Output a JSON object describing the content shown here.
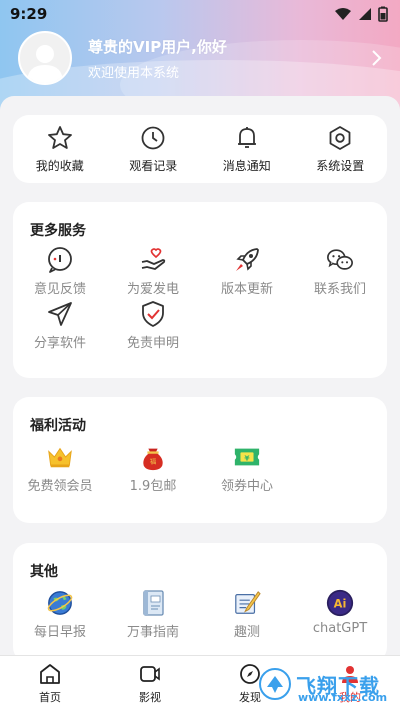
{
  "status": {
    "time": "9:29"
  },
  "profile": {
    "title": "尊贵的VIP用户,你好",
    "subtitle": "欢迎使用本系统"
  },
  "quick_actions": [
    {
      "label": "我的收藏",
      "icon": "star-icon"
    },
    {
      "label": "观看记录",
      "icon": "clock-icon"
    },
    {
      "label": "消息通知",
      "icon": "bell-icon"
    },
    {
      "label": "系统设置",
      "icon": "gear-icon"
    }
  ],
  "more_services": {
    "title": "更多服务",
    "items": [
      {
        "label": "意见反馈",
        "icon": "feedback-icon"
      },
      {
        "label": "为爱发电",
        "icon": "heart-hand-icon"
      },
      {
        "label": "版本更新",
        "icon": "rocket-icon"
      },
      {
        "label": "联系我们",
        "icon": "wechat-icon"
      },
      {
        "label": "分享软件",
        "icon": "paper-plane-icon"
      },
      {
        "label": "免责申明",
        "icon": "shield-check-icon"
      }
    ]
  },
  "welfare": {
    "title": "福利活动",
    "items": [
      {
        "label": "免费领会员",
        "icon": "crown-icon"
      },
      {
        "label": "1.9包邮",
        "icon": "lucky-bag-icon"
      },
      {
        "label": "领券中心",
        "icon": "coupon-icon"
      }
    ]
  },
  "other": {
    "title": "其他",
    "items": [
      {
        "label": "每日早报",
        "icon": "globe-icon"
      },
      {
        "label": "万事指南",
        "icon": "book-icon"
      },
      {
        "label": "趣测",
        "icon": "quiz-icon"
      },
      {
        "label": "chatGPT",
        "icon": "ai-icon"
      }
    ]
  },
  "tabs": [
    {
      "label": "首页",
      "icon": "home-icon"
    },
    {
      "label": "影视",
      "icon": "video-icon"
    },
    {
      "label": "发现",
      "icon": "discover-icon"
    },
    {
      "label": "我的",
      "icon": "profile-icon",
      "active": true
    }
  ],
  "watermark": {
    "text": "飞翔下载",
    "url": "www.fxxz.com"
  },
  "colors": {
    "accent": "#e23333",
    "header_left": "#8fc6f0",
    "header_right": "#f3a9c3"
  }
}
